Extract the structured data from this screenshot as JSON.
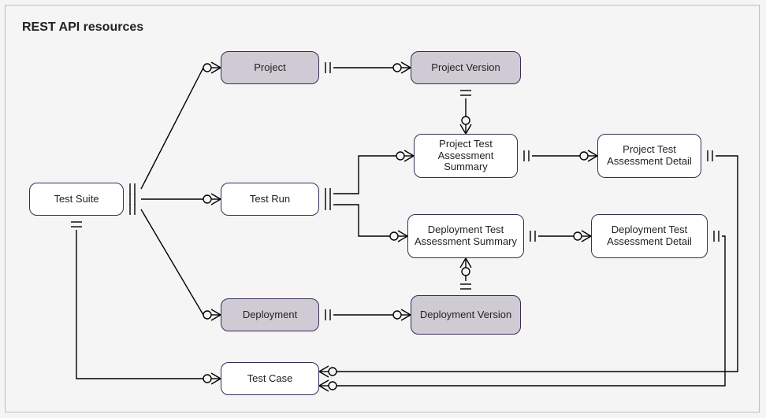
{
  "title": "REST API resources",
  "entities": {
    "test_suite": {
      "label": "Test Suite"
    },
    "project": {
      "label": "Project"
    },
    "project_version": {
      "label": "Project Version"
    },
    "test_run": {
      "label": "Test Run"
    },
    "proj_summary": {
      "label": "Project Test Assessment Summary"
    },
    "proj_detail": {
      "label": "Project Test Assessment Detail"
    },
    "depl_summary": {
      "label": "Deployment Test Assessment Summary"
    },
    "depl_detail": {
      "label": "Deployment Test Assessment Detail"
    },
    "deployment": {
      "label": "Deployment"
    },
    "depl_version": {
      "label": "Deployment Version"
    },
    "test_case": {
      "label": "Test Case"
    }
  },
  "relations": [
    {
      "from": "test_suite",
      "to": "project",
      "from_card": "one",
      "to_card": "many"
    },
    {
      "from": "test_suite",
      "to": "test_run",
      "from_card": "one",
      "to_card": "many"
    },
    {
      "from": "test_suite",
      "to": "deployment",
      "from_card": "one",
      "to_card": "many"
    },
    {
      "from": "test_suite",
      "to": "test_case",
      "from_card": "one",
      "to_card": "many"
    },
    {
      "from": "project",
      "to": "project_version",
      "from_card": "one",
      "to_card": "many"
    },
    {
      "from": "project_version",
      "to": "proj_summary",
      "from_card": "one",
      "to_card": "many"
    },
    {
      "from": "test_run",
      "to": "proj_summary",
      "from_card": "one",
      "to_card": "many"
    },
    {
      "from": "test_run",
      "to": "depl_summary",
      "from_card": "one",
      "to_card": "many"
    },
    {
      "from": "proj_summary",
      "to": "proj_detail",
      "from_card": "one",
      "to_card": "many"
    },
    {
      "from": "depl_summary",
      "to": "depl_detail",
      "from_card": "one",
      "to_card": "many"
    },
    {
      "from": "deployment",
      "to": "depl_version",
      "from_card": "one",
      "to_card": "many"
    },
    {
      "from": "depl_version",
      "to": "depl_summary",
      "from_card": "one",
      "to_card": "many"
    },
    {
      "from": "proj_detail",
      "to": "test_case",
      "from_card": "one",
      "to_card": "many"
    },
    {
      "from": "depl_detail",
      "to": "test_case",
      "from_card": "one",
      "to_card": "many"
    }
  ]
}
